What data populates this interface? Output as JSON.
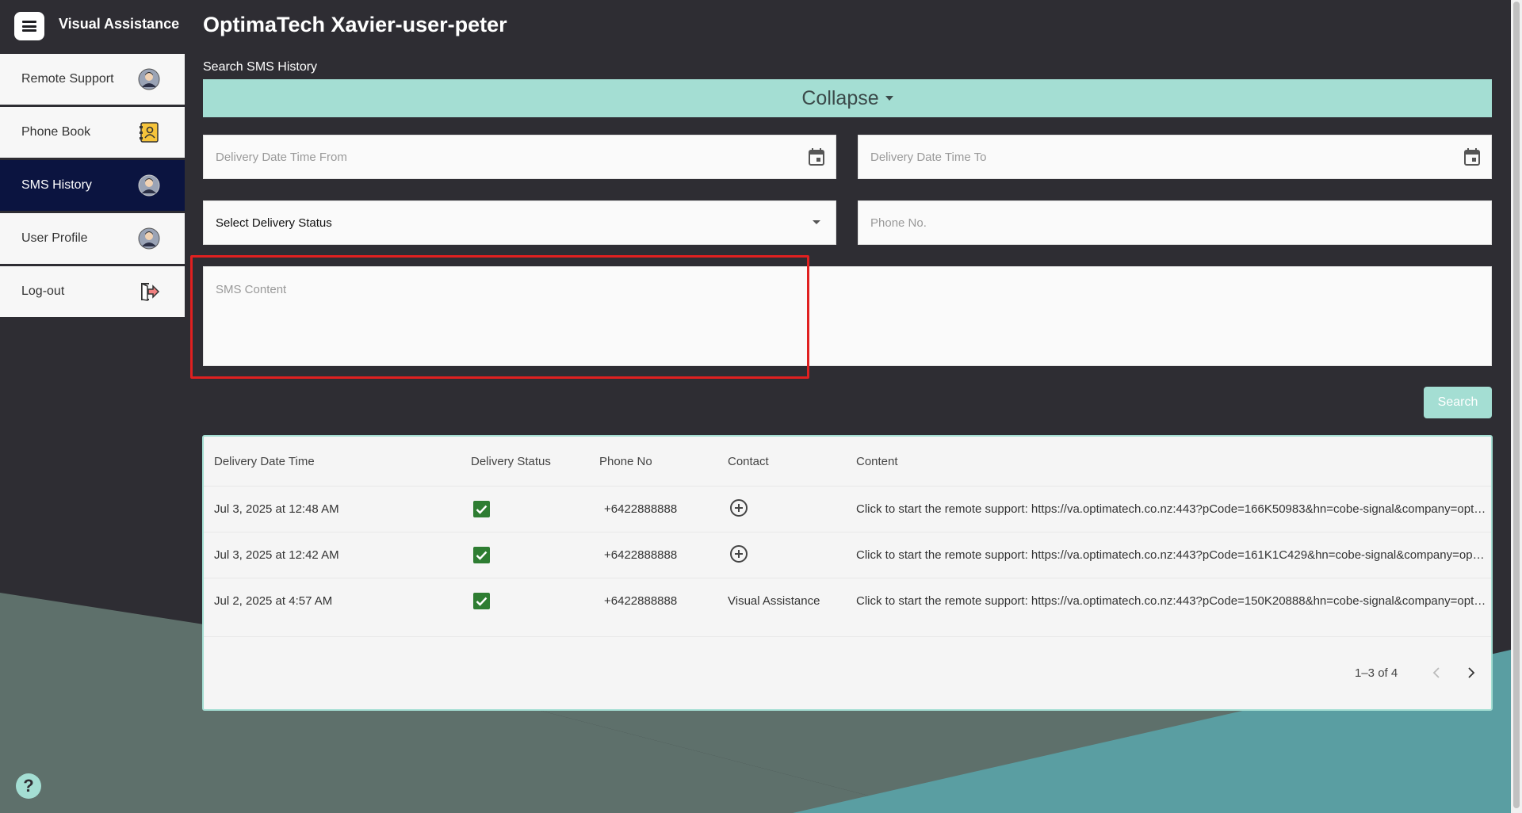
{
  "header": {
    "app_name": "Visual Assistance",
    "page_title": "OptimaTech Xavier-user-peter"
  },
  "sidebar": {
    "items": [
      {
        "label": "Remote Support",
        "icon": "user-avatar-icon",
        "active": false
      },
      {
        "label": "Phone Book",
        "icon": "contact-book-icon",
        "active": false
      },
      {
        "label": "SMS History",
        "icon": "user-avatar-icon",
        "active": true
      },
      {
        "label": "User Profile",
        "icon": "user-avatar-icon",
        "active": false
      },
      {
        "label": "Log-out",
        "icon": "logout-icon",
        "active": false
      }
    ]
  },
  "search": {
    "section_label": "Search SMS History",
    "collapse_label": "Collapse",
    "date_from_placeholder": "Delivery Date Time From",
    "date_to_placeholder": "Delivery Date Time To",
    "status_select_value": "Select Delivery Status",
    "phone_placeholder": "Phone No.",
    "content_placeholder": "SMS Content",
    "search_button": "Search"
  },
  "table": {
    "columns": [
      "Delivery Date Time",
      "Delivery Status",
      "Phone No",
      "Contact",
      "Content"
    ],
    "rows": [
      {
        "date": "Jul 3, 2025 at 12:48 AM",
        "status_delivered": true,
        "phone": "+6422888888",
        "contact": "",
        "contact_icon": "add-contact-icon",
        "content": "Click to start the remote support: https://va.optimatech.co.nz:443?pCode=166K50983&hn=cobe-signal&company=optimatech"
      },
      {
        "date": "Jul 3, 2025 at 12:42 AM",
        "status_delivered": true,
        "phone": "+6422888888",
        "contact": "",
        "contact_icon": "add-contact-icon",
        "content": "Click to start the remote support: https://va.optimatech.co.nz:443?pCode=161K1C429&hn=cobe-signal&company=optimatech"
      },
      {
        "date": "Jul 2, 2025 at 4:57 AM",
        "status_delivered": true,
        "phone": "+6422888888",
        "contact": "Visual Assistance",
        "contact_icon": "",
        "content": "Click to start the remote support: https://va.optimatech.co.nz:443?pCode=150K20888&hn=cobe-signal&company=optimatech"
      }
    ],
    "pagination": "1–3 of 4"
  },
  "help": {
    "label": "?"
  },
  "colors": {
    "background": "#2e2d33",
    "accent": "#a4ded3",
    "active_nav": "#0b1440",
    "highlight": "#e02020",
    "check": "#2e7d32"
  }
}
